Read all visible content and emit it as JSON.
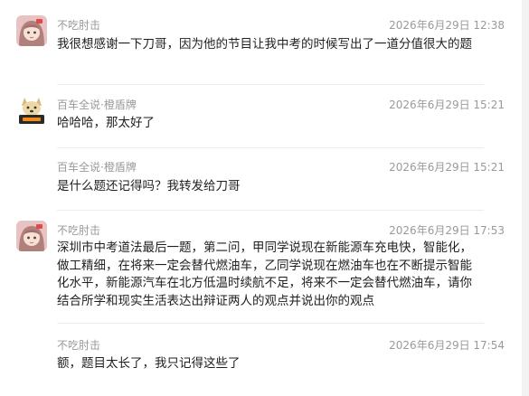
{
  "colors": {
    "text": "#1f1f1f",
    "meta": "#9a9a9a",
    "divider": "#ededed",
    "scrollbar": "#f2f2f2"
  },
  "messages": [
    {
      "author": "不吃肘击",
      "time": "2026年6月29日 12:38",
      "text": "我很想感谢一下刀哥，因为他的节目让我中考的时候写出了一道分值很大的题",
      "avatar_icon": "anime-girl-avatar-icon"
    },
    {
      "author": "百车全说·橙盾牌",
      "time": "2026年6月29日 15:21",
      "text": "哈哈哈，那太好了",
      "avatar_icon": "dog-mascot-avatar-icon"
    },
    {
      "author": "百车全说·橙盾牌",
      "time": "2026年6月29日 15:21",
      "text": "是什么题还记得吗？我转发给刀哥"
    },
    {
      "author": "不吃肘击",
      "time": "2026年6月29日 17:53",
      "text": "深圳市中考道法最后一题，第二问，甲同学说现在新能源车充电快，智能化，做工精细，在将来一定会替代燃油车，乙同学说现在燃油车也在不断提示智能化水平，新能源汽车在北方低温时续航不足，将来不一定会替代燃油车，请你结合所学和现实生活表达出辩证两人的观点并说出你的观点",
      "avatar_icon": "anime-girl-avatar-icon"
    },
    {
      "author": "不吃肘击",
      "time": "2026年6月29日 17:54",
      "text": "额，题目太长了，我只记得这些了"
    }
  ]
}
